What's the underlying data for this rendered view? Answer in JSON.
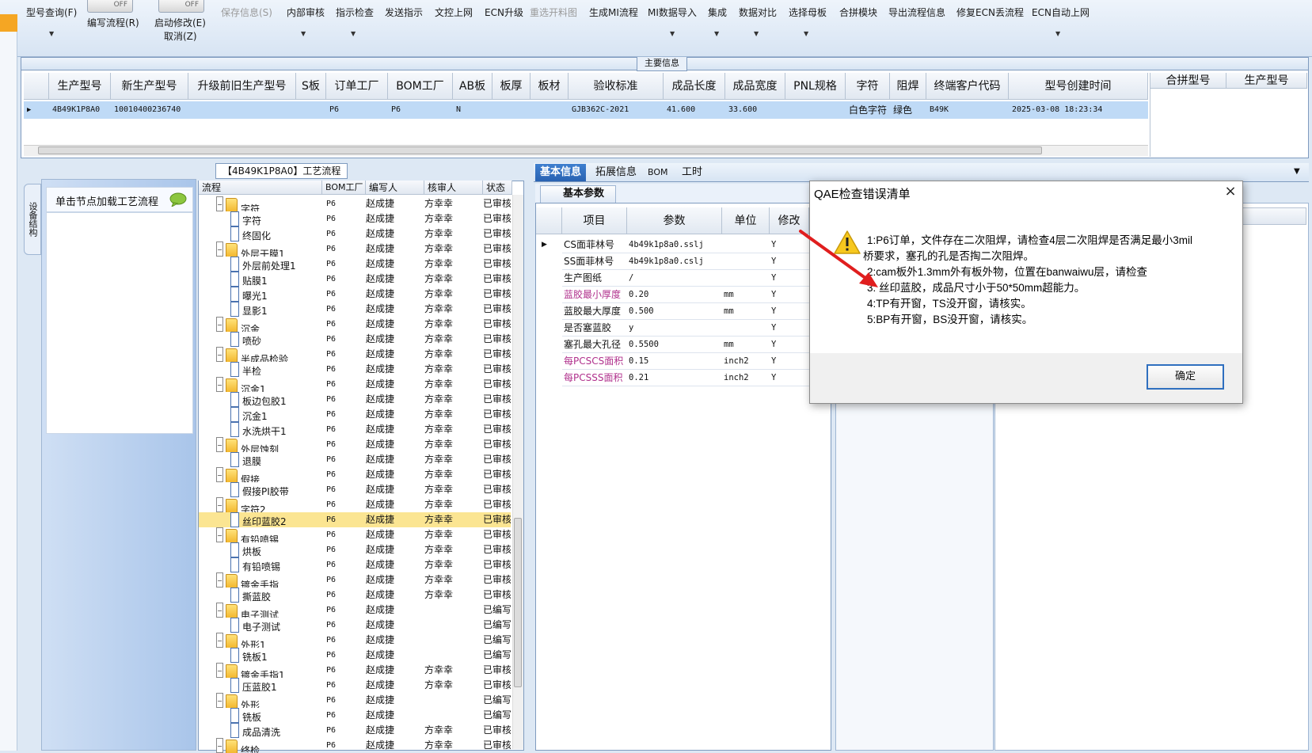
{
  "toolbar": {
    "items": [
      {
        "label": "型号查询(F)",
        "disabled": false
      },
      {
        "label": "编写流程(R)",
        "disabled": false
      },
      {
        "label": "启动修改(E)",
        "disabled": false
      },
      {
        "label": "取消(Z)",
        "disabled": false
      },
      {
        "label": "保存信息(S)",
        "disabled": true
      },
      {
        "label": "内部审核",
        "disabled": false
      },
      {
        "label": "指示检查",
        "disabled": false
      },
      {
        "label": "发送指示",
        "disabled": false
      },
      {
        "label": "文控上网",
        "disabled": false
      },
      {
        "label": "ECN升级",
        "disabled": false
      },
      {
        "label": "重选开料图",
        "disabled": true
      },
      {
        "label": "生成MI流程",
        "disabled": false
      },
      {
        "label": "MI数据导入",
        "disabled": false
      },
      {
        "label": "集成",
        "disabled": false
      },
      {
        "label": "数据对比",
        "disabled": false
      },
      {
        "label": "选择母板",
        "disabled": false
      },
      {
        "label": "合拼模块",
        "disabled": false
      },
      {
        "label": "导出流程信息",
        "disabled": false
      },
      {
        "label": "修复ECN丢流程",
        "disabled": false
      },
      {
        "label": "ECN自动上网",
        "disabled": false
      }
    ],
    "toggle_off": "OFF"
  },
  "main_info": {
    "title": "主要信息",
    "columns": [
      "生产型号",
      "新生产型号",
      "升级前旧生产型号",
      "S板",
      "订单工厂",
      "BOM工厂",
      "AB板",
      "板厚",
      "板材",
      "验收标准",
      "成品长度",
      "成品宽度",
      "PNL规格",
      "字符",
      "阻焊",
      "终端客户代码",
      "型号创建时间"
    ],
    "row": [
      "4B49K1P8A0",
      "10010400236740",
      "",
      "",
      "P6",
      "P6",
      "N",
      "",
      "",
      "GJB362C-2021",
      "41.600",
      "33.600",
      "",
      "白色字符",
      "绿色",
      "B49K",
      "2025-03-08 18:23:34"
    ],
    "merge_columns": [
      "合拼型号",
      "生产型号"
    ]
  },
  "side": {
    "tab_label": "设备结构",
    "nav_label": "单击节点加载工艺流程"
  },
  "tree": {
    "title": "【4B49K1P8A0】工艺流程",
    "columns": [
      "流程",
      "BOM工厂",
      "编写人",
      "核审人",
      "状态"
    ],
    "rows": [
      {
        "name": "字符",
        "lvl": 0,
        "f": "P6",
        "w": "赵成捷",
        "r": "方幸幸",
        "s": "已审核"
      },
      {
        "name": "字符",
        "lvl": 1,
        "f": "P6",
        "w": "赵成捷",
        "r": "方幸幸",
        "s": "已审核"
      },
      {
        "name": "终固化",
        "lvl": 1,
        "f": "P6",
        "w": "赵成捷",
        "r": "方幸幸",
        "s": "已审核"
      },
      {
        "name": "外层干膜1",
        "lvl": 0,
        "f": "P6",
        "w": "赵成捷",
        "r": "方幸幸",
        "s": "已审核"
      },
      {
        "name": "外层前处理1",
        "lvl": 1,
        "f": "P6",
        "w": "赵成捷",
        "r": "方幸幸",
        "s": "已审核"
      },
      {
        "name": "贴膜1",
        "lvl": 1,
        "f": "P6",
        "w": "赵成捷",
        "r": "方幸幸",
        "s": "已审核"
      },
      {
        "name": "曝光1",
        "lvl": 1,
        "f": "P6",
        "w": "赵成捷",
        "r": "方幸幸",
        "s": "已审核"
      },
      {
        "name": "显影1",
        "lvl": 1,
        "f": "P6",
        "w": "赵成捷",
        "r": "方幸幸",
        "s": "已审核"
      },
      {
        "name": "沉金",
        "lvl": 0,
        "f": "P6",
        "w": "赵成捷",
        "r": "方幸幸",
        "s": "已审核"
      },
      {
        "name": "喷砂",
        "lvl": 1,
        "f": "P6",
        "w": "赵成捷",
        "r": "方幸幸",
        "s": "已审核"
      },
      {
        "name": "半成品检验",
        "lvl": 0,
        "f": "P6",
        "w": "赵成捷",
        "r": "方幸幸",
        "s": "已审核"
      },
      {
        "name": "半检",
        "lvl": 1,
        "f": "P6",
        "w": "赵成捷",
        "r": "方幸幸",
        "s": "已审核"
      },
      {
        "name": "沉金1",
        "lvl": 0,
        "f": "P6",
        "w": "赵成捷",
        "r": "方幸幸",
        "s": "已审核"
      },
      {
        "name": "板边包胶1",
        "lvl": 1,
        "f": "P6",
        "w": "赵成捷",
        "r": "方幸幸",
        "s": "已审核"
      },
      {
        "name": "沉金1",
        "lvl": 1,
        "f": "P6",
        "w": "赵成捷",
        "r": "方幸幸",
        "s": "已审核"
      },
      {
        "name": "水洗烘干1",
        "lvl": 1,
        "f": "P6",
        "w": "赵成捷",
        "r": "方幸幸",
        "s": "已审核"
      },
      {
        "name": "外层蚀刻",
        "lvl": 0,
        "f": "P6",
        "w": "赵成捷",
        "r": "方幸幸",
        "s": "已审核"
      },
      {
        "name": "退膜",
        "lvl": 1,
        "f": "P6",
        "w": "赵成捷",
        "r": "方幸幸",
        "s": "已审核"
      },
      {
        "name": "假接",
        "lvl": 0,
        "f": "P6",
        "w": "赵成捷",
        "r": "方幸幸",
        "s": "已审核"
      },
      {
        "name": "假接PI胶带",
        "lvl": 1,
        "f": "P6",
        "w": "赵成捷",
        "r": "方幸幸",
        "s": "已审核"
      },
      {
        "name": "字符2",
        "lvl": 0,
        "f": "P6",
        "w": "赵成捷",
        "r": "方幸幸",
        "s": "已审核"
      },
      {
        "name": "丝印蓝胶2",
        "lvl": 1,
        "f": "P6",
        "w": "赵成捷",
        "r": "方幸幸",
        "s": "已审核",
        "sel": true
      },
      {
        "name": "有铅喷锡",
        "lvl": 0,
        "f": "P6",
        "w": "赵成捷",
        "r": "方幸幸",
        "s": "已审核"
      },
      {
        "name": "烘板",
        "lvl": 1,
        "f": "P6",
        "w": "赵成捷",
        "r": "方幸幸",
        "s": "已审核"
      },
      {
        "name": "有铅喷锡",
        "lvl": 1,
        "f": "P6",
        "w": "赵成捷",
        "r": "方幸幸",
        "s": "已审核"
      },
      {
        "name": "镀金手指",
        "lvl": 0,
        "f": "P6",
        "w": "赵成捷",
        "r": "方幸幸",
        "s": "已审核"
      },
      {
        "name": "撕蓝胶",
        "lvl": 1,
        "f": "P6",
        "w": "赵成捷",
        "r": "方幸幸",
        "s": "已审核"
      },
      {
        "name": "电子测试",
        "lvl": 0,
        "f": "P6",
        "w": "赵成捷",
        "r": "",
        "s": "已编写"
      },
      {
        "name": "电子测试",
        "lvl": 1,
        "f": "P6",
        "w": "赵成捷",
        "r": "",
        "s": "已编写"
      },
      {
        "name": "外形1",
        "lvl": 0,
        "f": "P6",
        "w": "赵成捷",
        "r": "",
        "s": "已编写"
      },
      {
        "name": "铣板1",
        "lvl": 1,
        "f": "P6",
        "w": "赵成捷",
        "r": "",
        "s": "已编写"
      },
      {
        "name": "镀金手指1",
        "lvl": 0,
        "f": "P6",
        "w": "赵成捷",
        "r": "方幸幸",
        "s": "已审核"
      },
      {
        "name": "压蓝胶1",
        "lvl": 1,
        "f": "P6",
        "w": "赵成捷",
        "r": "方幸幸",
        "s": "已审核"
      },
      {
        "name": "外形",
        "lvl": 0,
        "f": "P6",
        "w": "赵成捷",
        "r": "",
        "s": "已编写"
      },
      {
        "name": "铣板",
        "lvl": 1,
        "f": "P6",
        "w": "赵成捷",
        "r": "",
        "s": "已编写"
      },
      {
        "name": "成品清洗",
        "lvl": 1,
        "f": "P6",
        "w": "赵成捷",
        "r": "方幸幸",
        "s": "已审核"
      },
      {
        "name": "终检",
        "lvl": 0,
        "f": "P6",
        "w": "赵成捷",
        "r": "方幸幸",
        "s": "已审核"
      }
    ]
  },
  "tabs": [
    "基本信息",
    "拓展信息",
    "BOM",
    "工时"
  ],
  "subtab": "基本参数",
  "params": {
    "columns": [
      "项目",
      "参数",
      "单位",
      "修改"
    ],
    "rows": [
      {
        "item": "CS面菲林号",
        "value": "4b49k1p8a0.sslj",
        "unit": "",
        "mod": "Y",
        "hl": false
      },
      {
        "item": "SS面菲林号",
        "value": "4b49k1p8a0.cslj",
        "unit": "",
        "mod": "Y",
        "hl": false
      },
      {
        "item": "生产图纸",
        "value": "/",
        "unit": "",
        "mod": "Y",
        "hl": false
      },
      {
        "item": "蓝胶最小厚度",
        "value": "0.20",
        "unit": "mm",
        "mod": "Y",
        "hl": true
      },
      {
        "item": "蓝胶最大厚度",
        "value": "0.500",
        "unit": "mm",
        "mod": "Y",
        "hl": false
      },
      {
        "item": "是否塞蓝胶",
        "value": "y",
        "unit": "",
        "mod": "Y",
        "hl": false
      },
      {
        "item": "塞孔最大孔径",
        "value": "0.5500",
        "unit": "mm",
        "mod": "Y",
        "hl": false
      },
      {
        "item": "每PCSCS面积",
        "value": "0.15",
        "unit": "inch2",
        "mod": "Y",
        "hl": true
      },
      {
        "item": "每PCSSS面积",
        "value": "0.21",
        "unit": "inch2",
        "mod": "Y",
        "hl": true
      }
    ]
  },
  "dialog": {
    "title": "QAE检查错误清单",
    "close": "×",
    "lines": [
      "1:P6订单，文件存在二次阻焊，请检查4层二次阻焊是否满足最小3mil",
      "桥要求，塞孔的孔是否掏二次阻焊。",
      "2:cam板外1.3mm外有板外物，位置在banwaiwu层，请检查",
      "3: 丝印蓝胶，成品尺寸小于50*50mm超能力。",
      "4:TP有开窗，TS没开窗，请核实。",
      "5:BP有开窗，BS没开窗，请核实。"
    ],
    "ok_label": "确定"
  },
  "colors": {
    "accent": "#2862b2",
    "selected_row": "#bfdaf6",
    "selected_tree": "#fbe592",
    "highlight_text": "#b0308c",
    "arrow": "#e01e1e"
  }
}
